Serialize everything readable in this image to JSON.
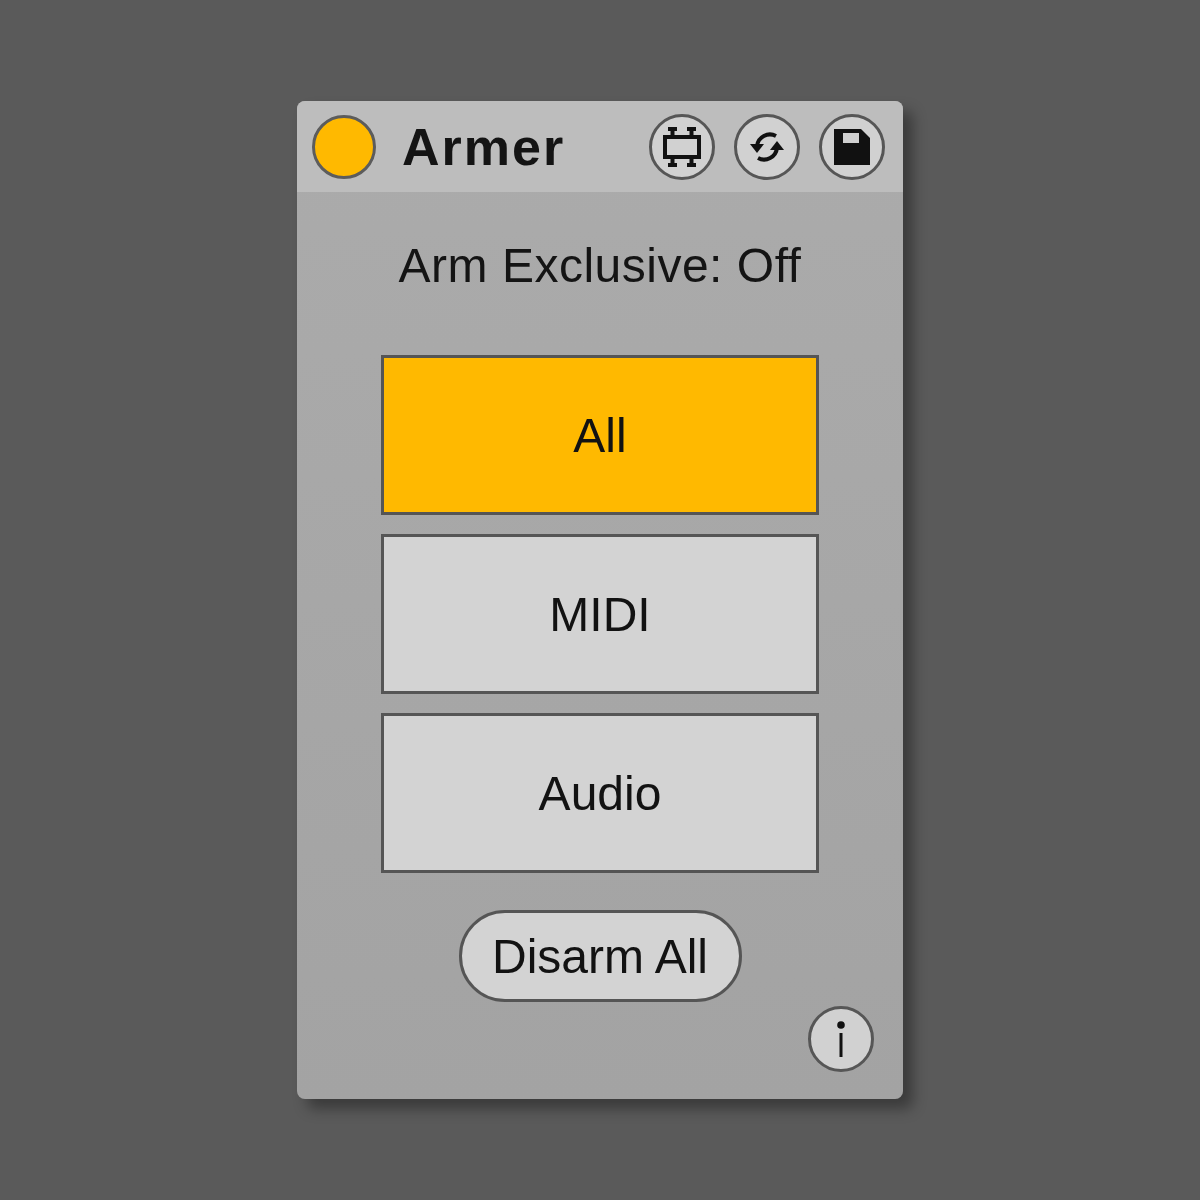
{
  "device": {
    "title": "Armer",
    "on": true
  },
  "status": "Arm Exclusive: Off",
  "arm_buttons": [
    {
      "label": "All",
      "on": true
    },
    {
      "label": "MIDI",
      "on": false
    },
    {
      "label": "Audio",
      "on": false
    }
  ],
  "disarm_button": {
    "label": "Disarm All"
  }
}
